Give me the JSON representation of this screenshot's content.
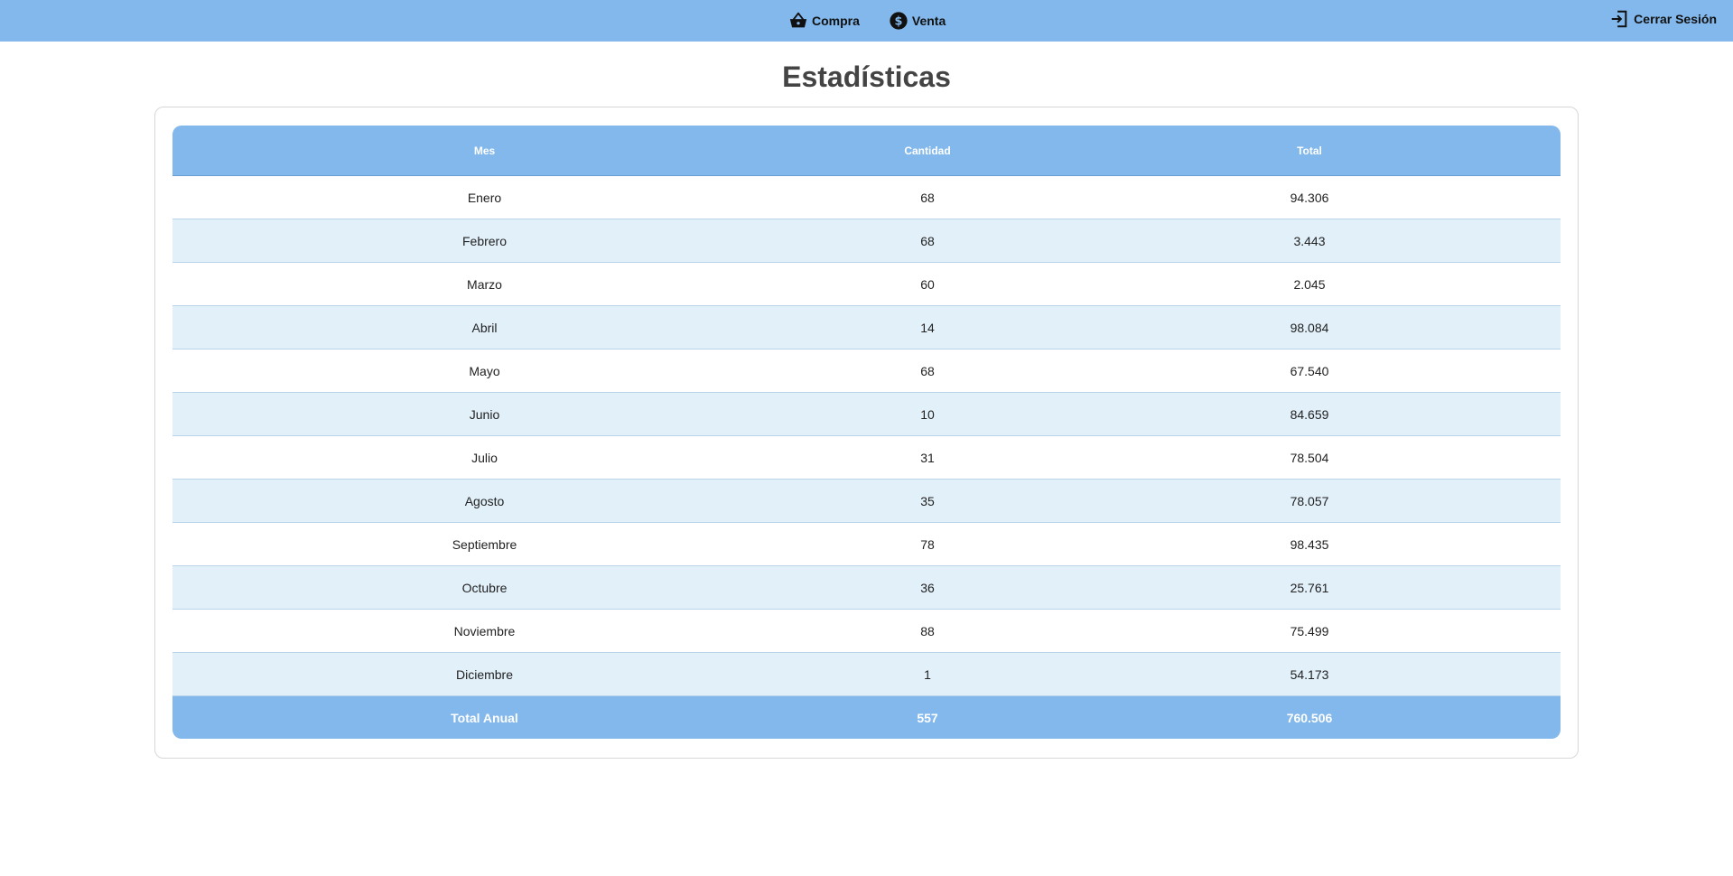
{
  "nav": {
    "compra_label": "Compra",
    "venta_label": "Venta",
    "logout_label": "Cerrar Sesión",
    "compra_icon": "shopping-basket-icon",
    "venta_icon": "dollar-circle-icon",
    "logout_icon": "logout-icon"
  },
  "page": {
    "title": "Estadísticas"
  },
  "table": {
    "headers": [
      "Mes",
      "Cantidad",
      "Total"
    ],
    "rows": [
      {
        "mes": "Enero",
        "cantidad": "68",
        "total": "94.306"
      },
      {
        "mes": "Febrero",
        "cantidad": "68",
        "total": "3.443"
      },
      {
        "mes": "Marzo",
        "cantidad": "60",
        "total": "2.045"
      },
      {
        "mes": "Abril",
        "cantidad": "14",
        "total": "98.084"
      },
      {
        "mes": "Mayo",
        "cantidad": "68",
        "total": "67.540"
      },
      {
        "mes": "Junio",
        "cantidad": "10",
        "total": "84.659"
      },
      {
        "mes": "Julio",
        "cantidad": "31",
        "total": "78.504"
      },
      {
        "mes": "Agosto",
        "cantidad": "35",
        "total": "78.057"
      },
      {
        "mes": "Septiembre",
        "cantidad": "78",
        "total": "98.435"
      },
      {
        "mes": "Octubre",
        "cantidad": "36",
        "total": "25.761"
      },
      {
        "mes": "Noviembre",
        "cantidad": "88",
        "total": "75.499"
      },
      {
        "mes": "Diciembre",
        "cantidad": "1",
        "total": "54.173"
      }
    ],
    "footer": {
      "label": "Total Anual",
      "cantidad": "557",
      "total": "760.506"
    }
  },
  "colors": {
    "header_bg": "#82b8eb",
    "row_alt_bg": "#e2f0fa",
    "title_text": "#444444"
  }
}
